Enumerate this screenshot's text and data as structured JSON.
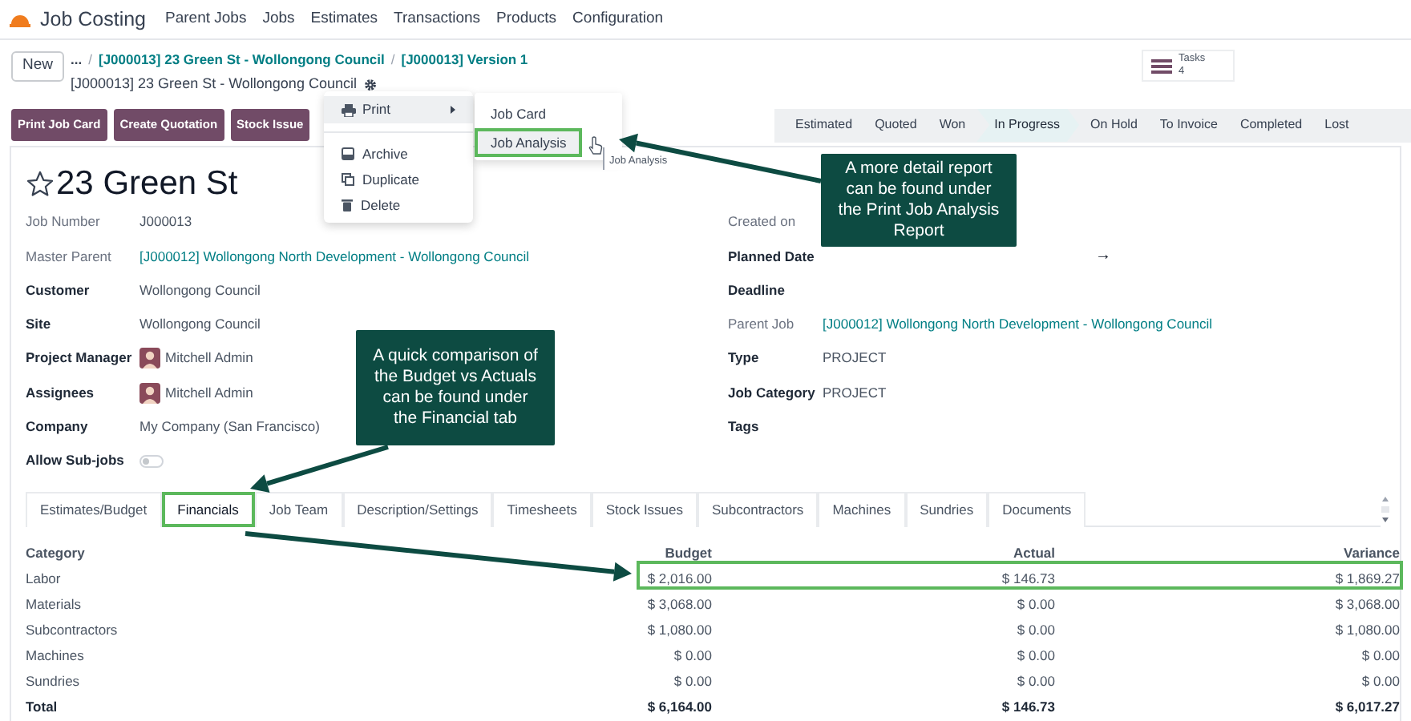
{
  "app": {
    "name": "Job Costing"
  },
  "menu": [
    "Parent Jobs",
    "Jobs",
    "Estimates",
    "Transactions",
    "Products",
    "Configuration"
  ],
  "breadcrumb": {
    "new_button": "New",
    "more": "...",
    "links": [
      {
        "separator": "/",
        "label": "[J000013] 23 Green St - Wollongong Council"
      },
      {
        "separator": "/",
        "label": "[J000013] Version 1"
      }
    ],
    "current": "[J000013] 23 Green St - Wollongong Council"
  },
  "smart_buttons": [
    {
      "label": "Tasks",
      "count": "4"
    }
  ],
  "action_buttons": [
    "Print Job Card",
    "Create Quotation",
    "Stock Issue"
  ],
  "stages": [
    {
      "label": "Estimated",
      "selected": false
    },
    {
      "label": "Quoted",
      "selected": false
    },
    {
      "label": "Won",
      "selected": false
    },
    {
      "label": "In Progress",
      "selected": true
    },
    {
      "label": "On Hold",
      "selected": false
    },
    {
      "label": "To Invoice",
      "selected": false
    },
    {
      "label": "Completed",
      "selected": false
    },
    {
      "label": "Lost",
      "selected": false
    }
  ],
  "record": {
    "title": "23 Green St",
    "starred": false
  },
  "left_fields": [
    {
      "label": "Job Number",
      "bold": false,
      "kind": "text",
      "value": "J000013"
    },
    {
      "label": "Master Parent",
      "bold": false,
      "kind": "link",
      "value": "[J000012] Wollongong North Development - Wollongong Council"
    },
    {
      "label": "Customer",
      "bold": true,
      "kind": "text",
      "value": "Wollongong Council"
    },
    {
      "label": "Site",
      "bold": true,
      "kind": "text",
      "value": "Wollongong Council"
    },
    {
      "label": "Project Manager",
      "bold": true,
      "kind": "avatar",
      "value": "Mitchell Admin"
    },
    {
      "label": "Assignees",
      "bold": true,
      "kind": "avatar",
      "value": "Mitchell Admin"
    },
    {
      "label": "Company",
      "bold": true,
      "kind": "text",
      "value": "My Company (San Francisco)"
    },
    {
      "label": "Allow Sub-jobs",
      "bold": true,
      "kind": "toggle",
      "on": false
    }
  ],
  "right_fields": [
    {
      "label": "Created on",
      "bold": false,
      "kind": "empty"
    },
    {
      "label": "Planned Date",
      "bold": true,
      "kind": "daterange",
      "value": "→"
    },
    {
      "label": "Deadline",
      "bold": true,
      "kind": "empty"
    },
    {
      "label": "Parent Job",
      "bold": false,
      "kind": "link",
      "value": "[J000012] Wollongong North Development - Wollongong Council"
    },
    {
      "label": "Type",
      "bold": true,
      "kind": "text",
      "value": "PROJECT"
    },
    {
      "label": "Job Category",
      "bold": true,
      "kind": "text",
      "value": "PROJECT"
    },
    {
      "label": "Tags",
      "bold": true,
      "kind": "empty"
    }
  ],
  "tabs": [
    {
      "label": "Estimates/Budget",
      "selected": false
    },
    {
      "label": "Financials",
      "selected": true
    },
    {
      "label": "Job Team",
      "selected": false
    },
    {
      "label": "Description/Settings",
      "selected": false
    },
    {
      "label": "Timesheets",
      "selected": false
    },
    {
      "label": "Stock Issues",
      "selected": false
    },
    {
      "label": "Subcontractors",
      "selected": false
    },
    {
      "label": "Machines",
      "selected": false
    },
    {
      "label": "Sundries",
      "selected": false
    },
    {
      "label": "Documents",
      "selected": false
    }
  ],
  "financials": {
    "columns": [
      "Category",
      "Budget",
      "Actual",
      "Variance"
    ],
    "rows": [
      {
        "kind": "line",
        "category": "Labor",
        "budget": "$ 2,016.00",
        "actual": "$ 146.73",
        "variance": "$ 1,869.27"
      },
      {
        "kind": "line",
        "category": "Materials",
        "budget": "$ 3,068.00",
        "actual": "$ 0.00",
        "variance": "$ 3,068.00"
      },
      {
        "kind": "line",
        "category": "Subcontractors",
        "budget": "$ 1,080.00",
        "actual": "$ 0.00",
        "variance": "$ 1,080.00"
      },
      {
        "kind": "line",
        "category": "Machines",
        "budget": "$ 0.00",
        "actual": "$ 0.00",
        "variance": "$ 0.00"
      },
      {
        "kind": "line",
        "category": "Sundries",
        "budget": "$ 0.00",
        "actual": "$ 0.00",
        "variance": "$ 0.00"
      },
      {
        "kind": "total",
        "category": "Total",
        "budget": "$ 6,164.00",
        "actual": "$ 146.73",
        "variance": "$ 6,017.27"
      }
    ]
  },
  "action_menu": {
    "print": {
      "label": "Print",
      "selected": true
    },
    "items": [
      {
        "label": "Archive",
        "selected": false
      },
      {
        "label": "Duplicate",
        "selected": false
      },
      {
        "label": "Delete",
        "selected": false
      }
    ],
    "submenu": [
      {
        "label": "Job Card",
        "selected": false
      },
      {
        "label": "Job Analysis",
        "selected": true
      }
    ],
    "tooltip": "Job Analysis"
  },
  "callouts": [
    "A more detail report can be found under the Print Job Analysis Report",
    "A quick comparison of the Budget vs Actuals can be found under the Financial tab"
  ]
}
